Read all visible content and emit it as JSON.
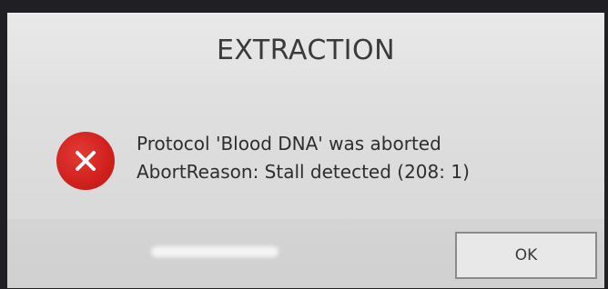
{
  "dialog": {
    "title": "EXTRACTION",
    "icon": "error-icon",
    "message_line1": "Protocol 'Blood DNA' was aborted",
    "message_line2": "AbortReason: Stall detected (208: 1)",
    "ok_label": "OK"
  },
  "colors": {
    "error_red": "#d0201c",
    "dialog_bg": "#e2e2e2",
    "text": "#2e2e2e"
  }
}
